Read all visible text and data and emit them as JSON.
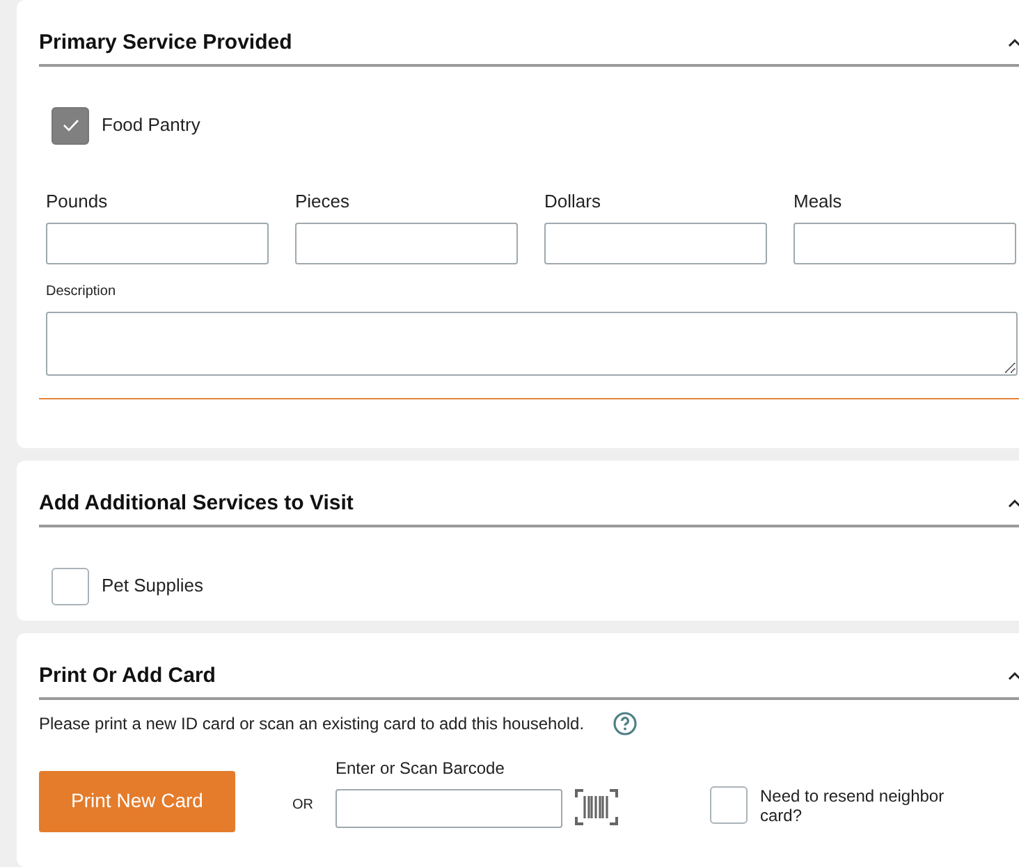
{
  "sections": [
    {
      "kind": "primary",
      "title": "Primary Service Provided",
      "expanded": true,
      "service": {
        "label": "Food Pantry",
        "checked": true
      },
      "fields": [
        {
          "label": "Pounds"
        },
        {
          "label": "Pieces"
        },
        {
          "label": "Dollars"
        },
        {
          "label": "Meals"
        }
      ],
      "description": {
        "label": "Description"
      }
    },
    {
      "kind": "additional",
      "title": "Add Additional Services to Visit",
      "expanded": true,
      "services": [
        {
          "label": "Pet Supplies",
          "checked": false
        }
      ]
    },
    {
      "kind": "card",
      "title": "Print Or Add Card",
      "expanded": true,
      "instructions": "Please print a new ID card or scan an existing card to add this household.",
      "print_button": "Print New Card",
      "or": "OR",
      "barcode_label": "Enter or Scan Barcode",
      "resend": {
        "label": "Need to resend neighbor card?",
        "checked": false
      }
    }
  ]
}
